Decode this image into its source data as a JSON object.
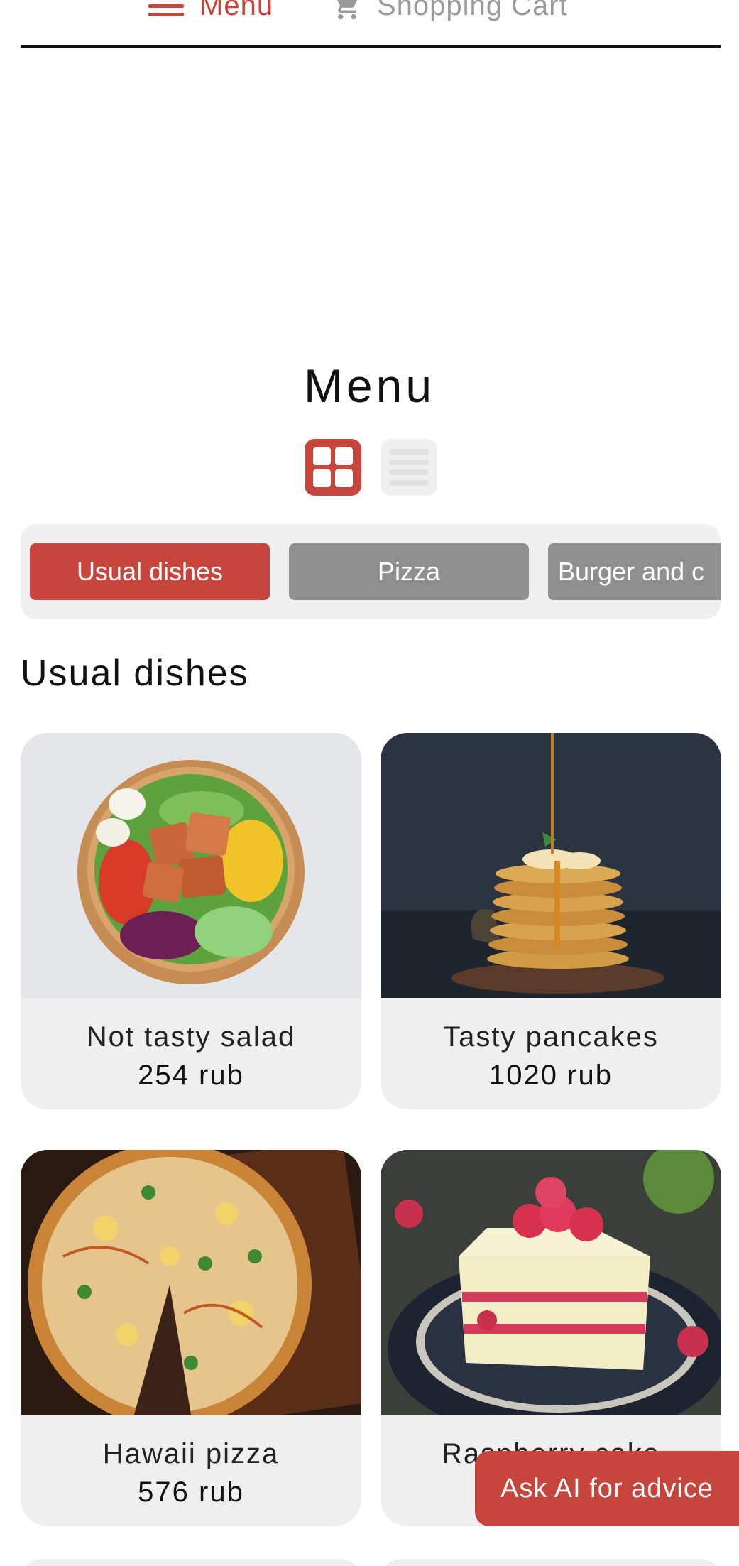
{
  "nav": {
    "menu_label": "Menu",
    "cart_label": "Shopping Cart"
  },
  "page": {
    "title": "Menu",
    "view_options": [
      "grid-view-icon",
      "list-view-icon"
    ],
    "selected_view": "grid"
  },
  "categories": [
    {
      "label": "Usual dishes",
      "active": true
    },
    {
      "label": "Pizza",
      "active": false
    },
    {
      "label": "Burger and c",
      "active": false
    }
  ],
  "section": {
    "title": "Usual dishes"
  },
  "products": [
    {
      "name": "Not tasty salad",
      "price": "254 rub",
      "image": "salad-bowl"
    },
    {
      "name": "Tasty pancakes",
      "price": "1020 rub",
      "image": "pancake-stack"
    },
    {
      "name": "Hawaii pizza",
      "price": "576 rub",
      "image": "pizza"
    },
    {
      "name": "Raspberry cake",
      "price": "",
      "image": "raspberry-cake"
    }
  ],
  "ask_ai": {
    "label": "Ask AI for advice"
  },
  "colors": {
    "accent": "#c6463d",
    "inactive_tab": "#8f8f8f",
    "card_bg": "#efefef"
  }
}
